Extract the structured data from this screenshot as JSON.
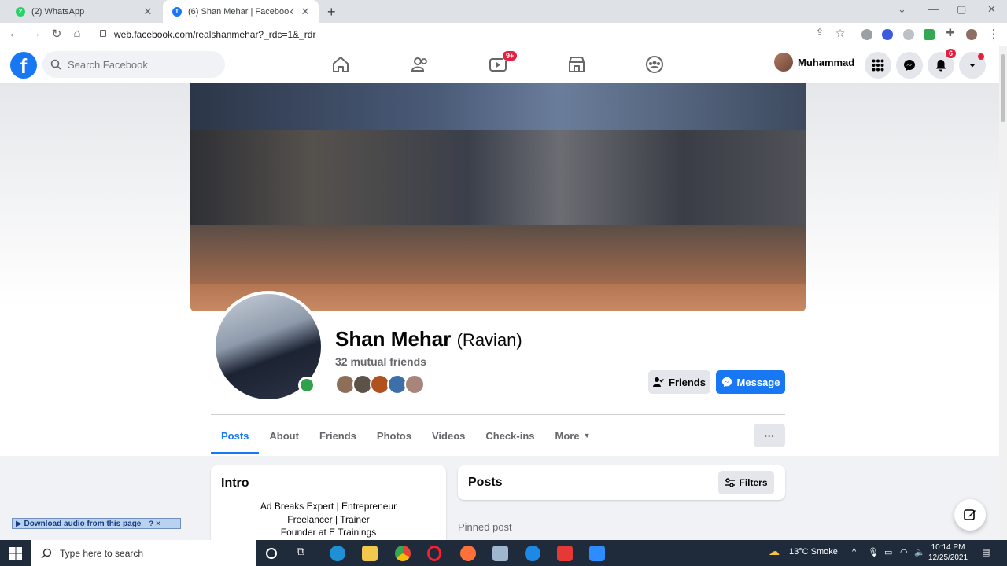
{
  "browser": {
    "tabs": [
      {
        "title": "(2) WhatsApp",
        "favicon_badge": "2",
        "color": "#25d366"
      },
      {
        "title": "(6) Shan Mehar | Facebook",
        "favicon_badge": "f",
        "color": "#1877f2"
      }
    ],
    "new_tab": "+",
    "url": "web.facebook.com/realshanmehar?_rdc=1&_rdr"
  },
  "fb": {
    "search_placeholder": "Search Facebook",
    "watch_badge": "9+",
    "notif_badge": "6",
    "user_name": "Muhammad",
    "brand_color": "#1877f2"
  },
  "profile": {
    "name": "Shan Mehar",
    "alt_name": "(Ravian)",
    "mutual": "32 mutual friends",
    "friends_btn": "Friends",
    "message_btn": "Message",
    "tabs": [
      "Posts",
      "About",
      "Friends",
      "Photos",
      "Videos",
      "Check-ins",
      "More"
    ],
    "more_btn": "···"
  },
  "intro": {
    "title": "Intro",
    "lines": [
      "Ad Breaks Expert | Entrepreneur",
      "Freelancer | Trainer",
      "Founder at E Trainings"
    ]
  },
  "posts": {
    "title": "Posts",
    "filters": "Filters",
    "pinned": "Pinned post"
  },
  "download_bar": "▶ Download audio from this page",
  "download_bar_ctrls": "? ✕",
  "taskbar": {
    "search_placeholder": "Type here to search",
    "weather": "13°C  Smoke",
    "time": "10:14 PM",
    "date": "12/25/2021"
  }
}
